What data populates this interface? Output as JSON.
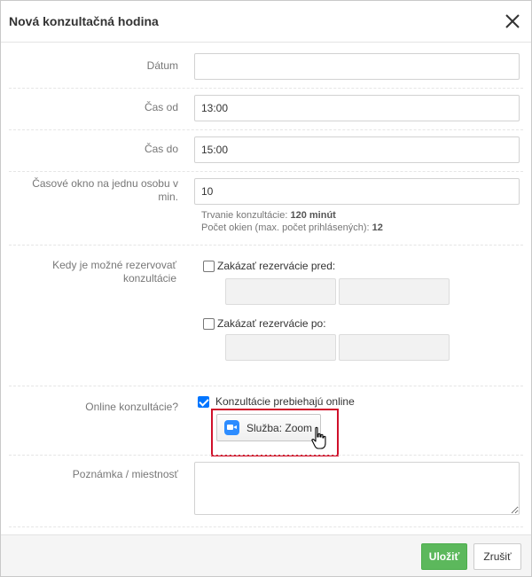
{
  "modal": {
    "title": "Nová konzultačná hodina",
    "close_icon": "close-icon"
  },
  "form": {
    "date": {
      "label": "Dátum",
      "value": ""
    },
    "time_from": {
      "label": "Čas od",
      "value": "13:00"
    },
    "time_to": {
      "label": "Čas do",
      "value": "15:00"
    },
    "slot": {
      "label_line1": "Časové okno na jednu osobu v",
      "label_line2": "min.",
      "value": "10",
      "duration_prefix": "Trvanie konzultácie:",
      "duration_value": "120 minút",
      "slots_prefix": "Počet okien (max. počet prihlásených):",
      "slots_value": "12"
    },
    "reservation": {
      "label_line1": "Kedy je možné rezervovať",
      "label_line2": "konzultácie",
      "before_label": "Zakázať rezervácie pred:",
      "before_checked": false,
      "after_label": "Zakázať rezervácie po:",
      "after_checked": false,
      "before_date": "",
      "before_time": "",
      "after_date": "",
      "after_time": ""
    },
    "online": {
      "label": "Online konzultácie?",
      "checkbox_label": "Konzultácie prebiehajú online",
      "checked": true,
      "service_label": "Služba: Zoom",
      "service_icon": "zoom-icon"
    },
    "note": {
      "label": "Poznámka / miestnosť",
      "value": ""
    }
  },
  "footer": {
    "save_label": "Uložiť",
    "cancel_label": "Zrušiť"
  },
  "colors": {
    "save_button": "#5cb85c",
    "highlight": "#d0102a",
    "checkbox_checked": "#0075ff",
    "zoom_blue": "#2d8cff"
  }
}
